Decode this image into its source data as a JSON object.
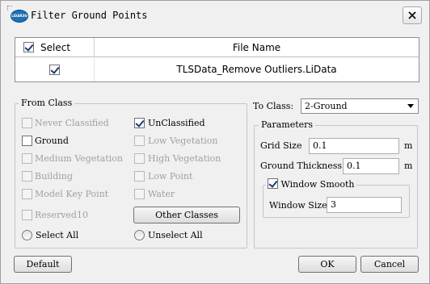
{
  "window": {
    "title": "Filter Ground Points",
    "icon_text": "LiDAR360"
  },
  "table": {
    "headers": {
      "select": "Select",
      "file_name": "File Name"
    },
    "rows": [
      {
        "checked": true,
        "file_name": "TLSData_Remove Outliers.LiData"
      }
    ]
  },
  "from_class": {
    "title": "From Class",
    "left_column": [
      {
        "label": "Never Classified",
        "checked": false,
        "enabled": false
      },
      {
        "label": "Ground",
        "checked": false,
        "enabled": true
      },
      {
        "label": "Medium Vegetation",
        "checked": false,
        "enabled": false
      },
      {
        "label": "Building",
        "checked": false,
        "enabled": false
      },
      {
        "label": "Model Key Point",
        "checked": false,
        "enabled": false
      },
      {
        "label": "Reserved10",
        "checked": false,
        "enabled": false
      }
    ],
    "right_column": [
      {
        "label": "UnClassified",
        "checked": true,
        "enabled": true
      },
      {
        "label": "Low Vegetation",
        "checked": false,
        "enabled": false
      },
      {
        "label": "High Vegetation",
        "checked": false,
        "enabled": false
      },
      {
        "label": "Low Point",
        "checked": false,
        "enabled": false
      },
      {
        "label": "Water",
        "checked": false,
        "enabled": false
      }
    ],
    "other_classes_button": "Other Classes",
    "select_all": "Select All",
    "unselect_all": "Unselect All"
  },
  "to_class": {
    "label": "To Class:",
    "value": "2-Ground"
  },
  "parameters": {
    "title": "Parameters",
    "grid_size": {
      "label": "Grid Size",
      "value": "0.1",
      "unit": "m"
    },
    "ground_thickness": {
      "label": "Ground Thickness",
      "value": "0.1",
      "unit": "m"
    },
    "window_smooth": {
      "label": "Window Smooth",
      "checked": true,
      "window_size": {
        "label": "Window Size",
        "value": "3"
      }
    }
  },
  "footer": {
    "default_button": "Default",
    "ok_button": "OK",
    "cancel_button": "Cancel"
  },
  "colors": {
    "background": "#f0f0f0",
    "checkmark": "#1b3a78",
    "disabled_text": "#a0a0a0"
  }
}
